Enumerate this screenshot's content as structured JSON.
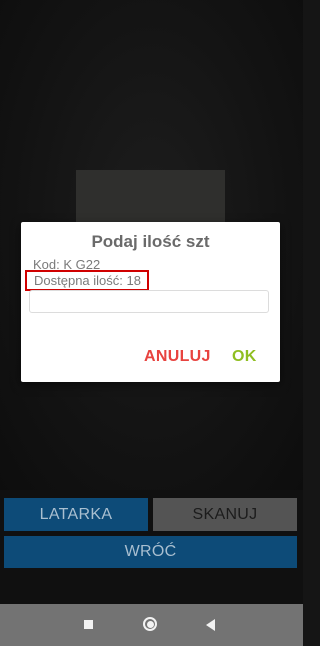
{
  "dialog": {
    "title": "Podaj ilość szt",
    "code_label": "Kod: K G22",
    "available_label": "Dostępna ilość: 18",
    "quantity_input": {
      "value": "",
      "placeholder": ""
    },
    "cancel_label": "ANULUJ",
    "ok_label": "OK"
  },
  "actions": {
    "flashlight_label": "LATARKA",
    "scan_label": "SKANUJ",
    "back_label": "WRÓĆ"
  },
  "system_nav": {
    "recents_icon": "square-icon",
    "home_icon": "circle-icon",
    "back_icon": "triangle-back-icon"
  },
  "colors": {
    "highlight_border": "#d00000",
    "cancel_text": "#e8433f",
    "ok_text": "#8fbe21",
    "primary_button_bg": "#0d4b78",
    "secondary_button_bg": "#545454"
  }
}
